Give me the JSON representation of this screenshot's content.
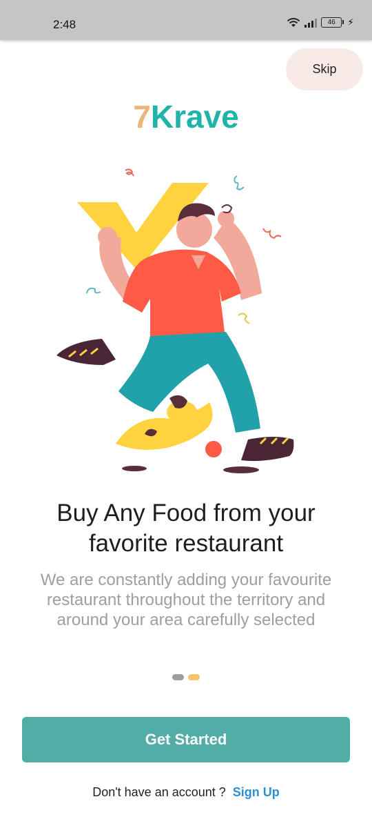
{
  "status_bar": {
    "time": "2:48",
    "battery_level": "46",
    "icons": [
      "wifi-icon",
      "signal-icon",
      "battery-icon",
      "charging-icon"
    ]
  },
  "header": {
    "skip_label": "Skip",
    "brand": {
      "digit": "7",
      "word": "Krave"
    }
  },
  "illustration": {
    "name": "man-running-with-checkmark-and-dog-illustration"
  },
  "onboarding": {
    "headline_line1": "Buy Any Food from your",
    "headline_line2": "favorite restaurant",
    "description": "We are constantly adding your favourite restaurant throughout the territory and around your area carefully selected",
    "pager": {
      "total": 2,
      "active_index": 1
    }
  },
  "actions": {
    "get_started_label": "Get Started",
    "no_account_text": "Don't have an account ?",
    "sign_up_label": "Sign Up"
  },
  "colors": {
    "accent_teal": "#52ada7",
    "brand_teal": "#20b3a9",
    "brand_orange": "#e9b77a",
    "link_blue": "#2a8fd4",
    "skip_bg": "#f8ebe7",
    "dot_inactive": "#9e9e9e",
    "dot_active": "#f5c36a"
  }
}
